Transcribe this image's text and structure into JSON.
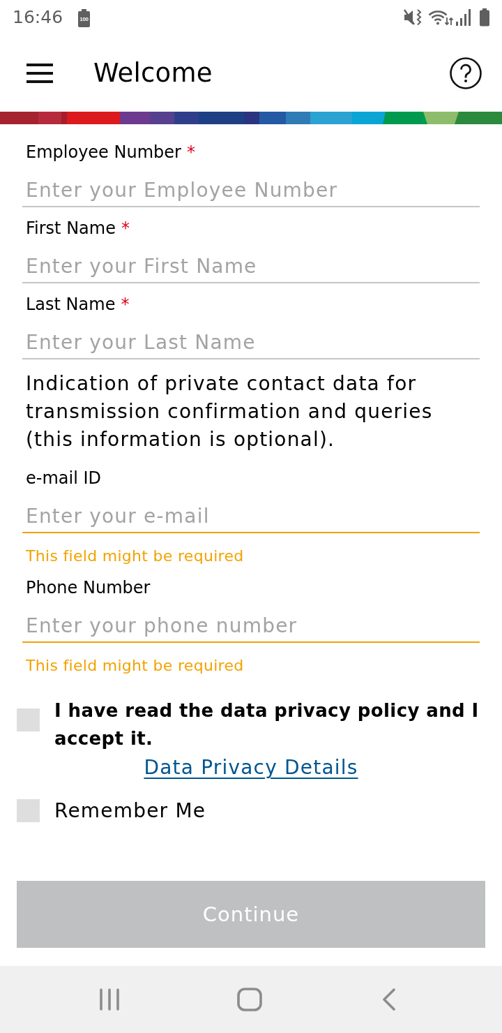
{
  "status_bar": {
    "time": "16:46",
    "battery_badge": "100"
  },
  "header": {
    "title": "Welcome"
  },
  "required_fields": [
    {
      "label": "Employee Number",
      "required_mark": "*",
      "placeholder": "Enter your Employee Number",
      "warning": false
    },
    {
      "label": "First Name",
      "required_mark": "*",
      "placeholder": "Enter your First Name",
      "warning": false
    },
    {
      "label": "Last Name",
      "required_mark": "*",
      "placeholder": "Enter your Last Name",
      "warning": false
    }
  ],
  "contact_note": "Indication of private contact data for transmission confirmation and queries (this information is optional).",
  "contact_fields": [
    {
      "label": "e-mail ID",
      "placeholder": "Enter your e-mail",
      "warning": true,
      "message": "This field might be required"
    },
    {
      "label": "Phone Number",
      "placeholder": "Enter your phone number",
      "warning": true,
      "message": "This field might be required"
    }
  ],
  "checkboxes": [
    {
      "kind": "consent",
      "label": "I have read the data privacy policy and I accept it.",
      "checked": false,
      "link": "Data Privacy Details"
    },
    {
      "kind": "plain",
      "label": "Remember Me",
      "checked": false
    }
  ],
  "continue_button": {
    "label": "Continue",
    "disabled": true
  }
}
